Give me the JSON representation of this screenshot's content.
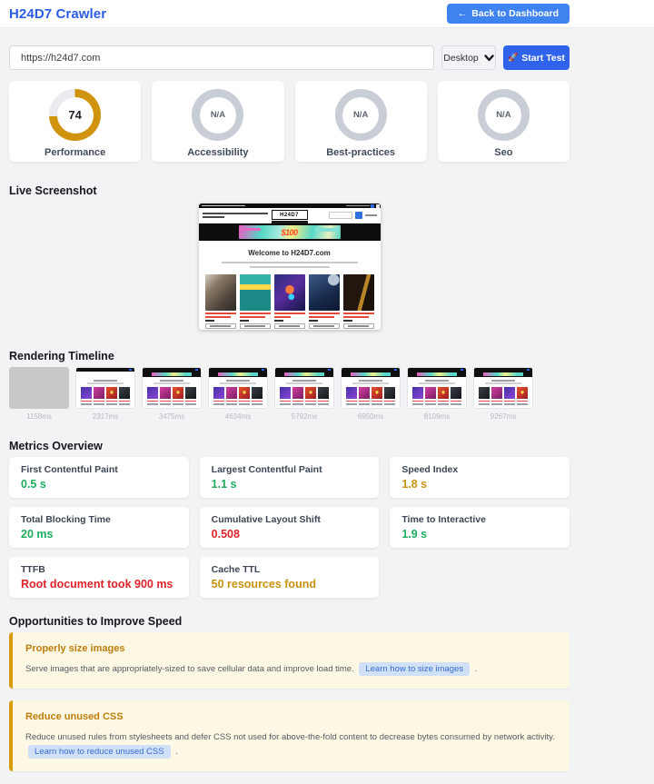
{
  "header": {
    "title": "H24D7 Crawler",
    "back_arrow": "←",
    "back_label": "Back to Dashboard"
  },
  "test_bar": {
    "url_value": "https://h24d7.com",
    "device": "Desktop",
    "start_icon": "🚀",
    "start_label": "Start Test"
  },
  "scores": [
    {
      "label": "Performance",
      "value": "74",
      "score": 74,
      "color": "#d0930d"
    },
    {
      "label": "Accessibility",
      "value": "N/A",
      "score": null
    },
    {
      "label": "Best-practices",
      "value": "N/A",
      "score": null
    },
    {
      "label": "Seo",
      "value": "N/A",
      "score": null
    }
  ],
  "live_screenshot": {
    "title": "Live Screenshot",
    "site_logo": "H24D7",
    "site_banner_text": "$100",
    "site_heading": "Welcome to H24D7.com"
  },
  "timeline": {
    "title": "Rendering Timeline",
    "frames": [
      {
        "time": "1158ms"
      },
      {
        "time": "2317ms"
      },
      {
        "time": "3475ms"
      },
      {
        "time": "4634ms"
      },
      {
        "time": "5792ms"
      },
      {
        "time": "6950ms"
      },
      {
        "time": "8109ms"
      },
      {
        "time": "9267ms"
      }
    ]
  },
  "metrics": {
    "title": "Metrics Overview",
    "cards": [
      {
        "label": "First Contentful Paint",
        "value": "0.5 s",
        "color": "#1cad5e"
      },
      {
        "label": "Largest Contentful Paint",
        "value": "1.1 s",
        "color": "#1cad5e"
      },
      {
        "label": "Speed Index",
        "value": "1.8 s",
        "color": "#c9920e"
      },
      {
        "label": "Total Blocking Time",
        "value": "20 ms",
        "color": "#1cad5e"
      },
      {
        "label": "Cumulative Layout Shift",
        "value": "0.508",
        "color": "#e0222a"
      },
      {
        "label": "Time to Interactive",
        "value": "1.9 s",
        "color": "#1cad5e"
      },
      {
        "label": "TTFB",
        "value": "Root document took 900 ms",
        "color": "#e0222a"
      },
      {
        "label": "Cache TTL",
        "value": "50 resources found",
        "color": "#c9920e"
      }
    ]
  },
  "opportunities": {
    "title": "Opportunities to Improve Speed",
    "items": [
      {
        "heading": "Properly size images",
        "body": "Serve images that are appropriately-sized to save cellular data and improve load time.",
        "button": "Learn how to size images",
        "suffix": "."
      },
      {
        "heading": "Reduce unused CSS",
        "body": "Reduce unused rules from stylesheets and defer CSS not used for above-the-fold content to decrease bytes consumed by network activity.",
        "button": "Learn how to reduce unused CSS",
        "suffix": "."
      }
    ]
  }
}
